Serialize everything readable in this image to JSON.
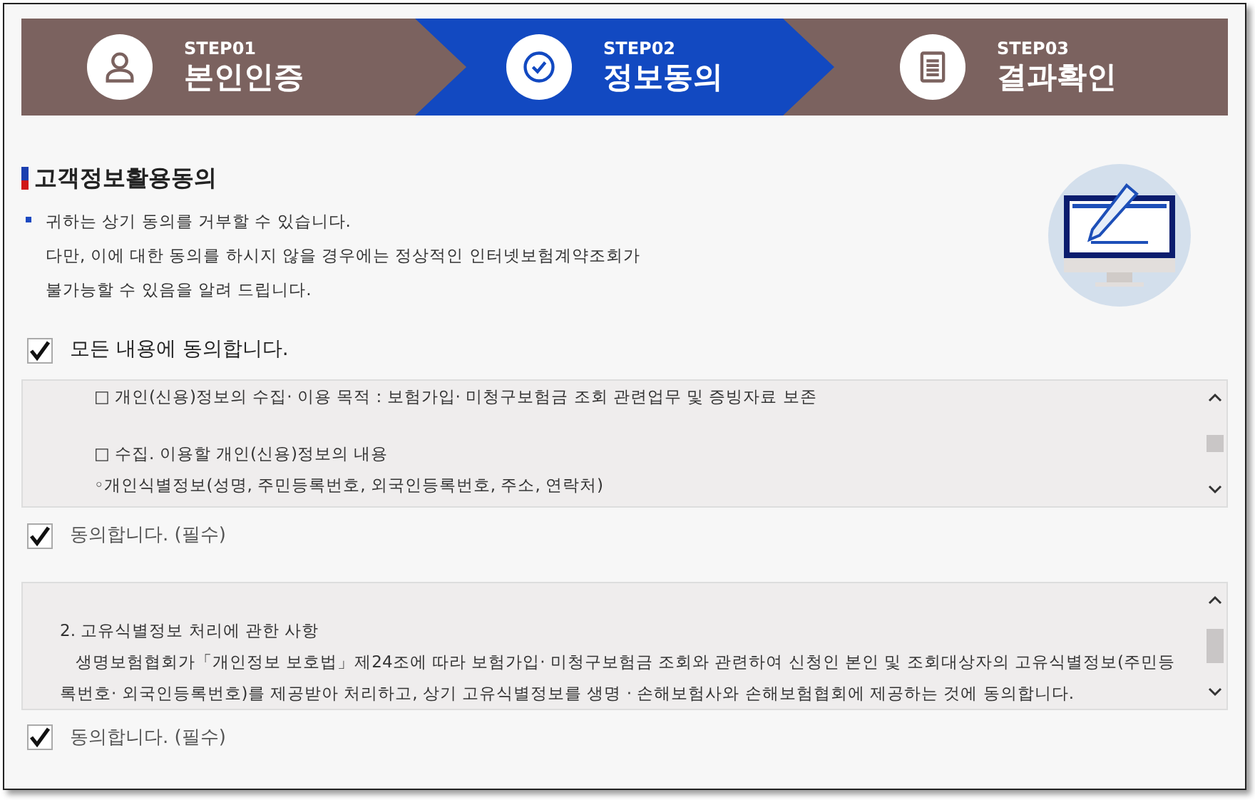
{
  "steps": [
    {
      "label": "STEP01",
      "title": "본인인증",
      "kind": "person",
      "selected": false
    },
    {
      "label": "STEP02",
      "title": "정보동의",
      "kind": "check",
      "selected": true
    },
    {
      "label": "STEP03",
      "title": "결과확인",
      "kind": "document",
      "selected": false
    }
  ],
  "section": {
    "title": "고객정보활용동의",
    "notice": [
      "귀하는 상기 동의를 거부할 수 있습니다.",
      "다만, 이에 대한 동의를 하시지 않을 경우에는 정상적인 인터넷보험계약조회가",
      "불가능할 수 있음을 알려 드립니다."
    ]
  },
  "agree_all": {
    "label": "모든 내용에 동의합니다.",
    "checked": true
  },
  "consents": [
    {
      "blocks": [
        [
          "□ 개인(신용)정보의 수집· 이용 목적 : 보험가입· 미청구보험금 조회 관련업무 및 증빙자료 보존"
        ],
        [
          "□ 수집. 이용할 개인(신용)정보의 내용",
          "◦개인식별정보(성명, 주민등록번호, 외국인등록번호, 주소, 연락처)"
        ]
      ],
      "agree": {
        "label": "동의합니다. (필수)",
        "checked": true
      }
    },
    {
      "blocks": [
        [
          "2. 고유식별정보 처리에 관한 사항",
          "   생명보험협회가「개인정보 보호법」제24조에 따라 보험가입· 미청구보험금 조회와 관련하여 신청인 본인 및 조회대상자의 고유식별정보(주민등록번호· 외국인등록번호)를 제공받아 처리하고, 상기 고유식별정보를 생명 · 손해보험사와 손해보험협회에 제공하는 것에 동의합니다."
        ]
      ],
      "agree": {
        "label": "동의합니다. (필수)",
        "checked": true
      }
    }
  ]
}
